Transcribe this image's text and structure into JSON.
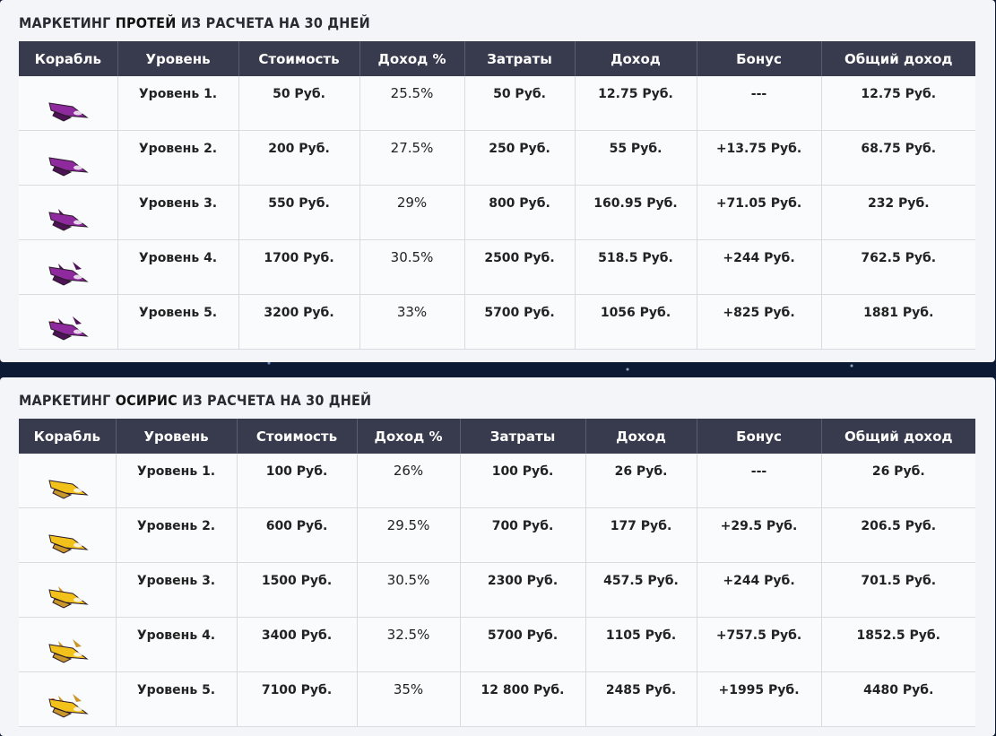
{
  "colors": {
    "header_bg": "#383b4d",
    "header_text": "#ffffff",
    "panel_bg": "#f4f5f8",
    "page_bg": "#0c1a33",
    "proteus_ship": "#8e2a9e",
    "osiris_ship": "#f2c21b"
  },
  "headers": [
    "Корабль",
    "Уровень",
    "Стоимость",
    "Доход %",
    "Затраты",
    "Доход",
    "Бонус",
    "Общий доход"
  ],
  "tables": [
    {
      "title_prefix": "МАРКЕТИНГ",
      "ship_name": "ПРОТЕЙ",
      "title_suffix": "ИЗ РАСЧЕТА НА 30 ДНЕЙ",
      "icon": "purple-spaceship-icon",
      "rows": [
        {
          "level": "Уровень 1.",
          "cost": "50 Руб.",
          "pct": "25.5%",
          "spent": "50 Руб.",
          "income": "12.75 Руб.",
          "bonus": "---",
          "total": "12.75 Руб."
        },
        {
          "level": "Уровень 2.",
          "cost": "200 Руб.",
          "pct": "27.5%",
          "spent": "250 Руб.",
          "income": "55 Руб.",
          "bonus": "+13.75 Руб.",
          "total": "68.75 Руб."
        },
        {
          "level": "Уровень 3.",
          "cost": "550 Руб.",
          "pct": "29%",
          "spent": "800 Руб.",
          "income": "160.95 Руб.",
          "bonus": "+71.05 Руб.",
          "total": "232 Руб."
        },
        {
          "level": "Уровень 4.",
          "cost": "1700 Руб.",
          "pct": "30.5%",
          "spent": "2500 Руб.",
          "income": "518.5 Руб.",
          "bonus": "+244 Руб.",
          "total": "762.5 Руб."
        },
        {
          "level": "Уровень 5.",
          "cost": "3200 Руб.",
          "pct": "33%",
          "spent": "5700 Руб.",
          "income": "1056 Руб.",
          "bonus": "+825 Руб.",
          "total": "1881 Руб."
        }
      ]
    },
    {
      "title_prefix": "МАРКЕТИНГ",
      "ship_name": "ОСИРИС",
      "title_suffix": "ИЗ РАСЧЕТА НА 30 ДНЕЙ",
      "icon": "yellow-spaceship-icon",
      "rows": [
        {
          "level": "Уровень 1.",
          "cost": "100 Руб.",
          "pct": "26%",
          "spent": "100 Руб.",
          "income": "26 Руб.",
          "bonus": "---",
          "total": "26 Руб."
        },
        {
          "level": "Уровень 2.",
          "cost": "600 Руб.",
          "pct": "29.5%",
          "spent": "700 Руб.",
          "income": "177 Руб.",
          "bonus": "+29.5 Руб.",
          "total": "206.5 Руб."
        },
        {
          "level": "Уровень 3.",
          "cost": "1500 Руб.",
          "pct": "30.5%",
          "spent": "2300 Руб.",
          "income": "457.5 Руб.",
          "bonus": "+244 Руб.",
          "total": "701.5 Руб."
        },
        {
          "level": "Уровень 4.",
          "cost": "3400 Руб.",
          "pct": "32.5%",
          "spent": "5700 Руб.",
          "income": "1105 Руб.",
          "bonus": "+757.5 Руб.",
          "total": "1852.5 Руб."
        },
        {
          "level": "Уровень 5.",
          "cost": "7100 Руб.",
          "pct": "35%",
          "spent": "12 800 Руб.",
          "income": "2485 Руб.",
          "bonus": "+1995 Руб.",
          "total": "4480 Руб."
        }
      ]
    }
  ]
}
